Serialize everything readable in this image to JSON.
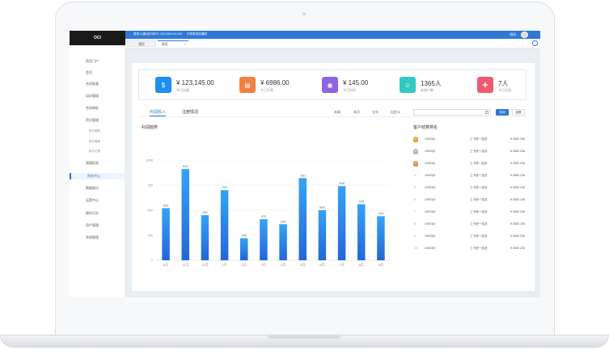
{
  "topbar": {
    "info": "登录人(最近访问IP): 192.168.104.216",
    "notice": "IP异常告知通知",
    "user": "测试"
  },
  "tabs": [
    {
      "label": "首页"
    },
    {
      "label": "首页",
      "close": "×"
    }
  ],
  "sidebar": {
    "logo": "OCI",
    "items": [
      {
        "label": "首页门户"
      },
      {
        "label": "会员"
      },
      {
        "label": "合同准备"
      },
      {
        "label": "培训管理"
      },
      {
        "label": "合同审批"
      },
      {
        "label": "积分管理"
      },
      {
        "label": "积分规则",
        "sub": true
      },
      {
        "label": "积分商城",
        "sub": true
      },
      {
        "label": "积分记录",
        "sub": true
      },
      {
        "label": "通量报表"
      },
      {
        "label": "财务中心",
        "active": true
      },
      {
        "label": "数据统计"
      },
      {
        "label": "运营中心"
      },
      {
        "label": "操作日志"
      },
      {
        "label": "用户管理"
      },
      {
        "label": "系统管理"
      }
    ]
  },
  "stats": [
    {
      "icon": "upload-money-icon",
      "color": "#1e8ff0",
      "value": "¥ 123,145.00",
      "label": "今日总额"
    },
    {
      "icon": "receipt-icon",
      "color": "#f08140",
      "value": "¥ 6986.00",
      "label": "今日开票"
    },
    {
      "icon": "coins-icon",
      "color": "#8e63e6",
      "value": "¥ 145.00",
      "label": "今日利润"
    },
    {
      "icon": "users-icon",
      "color": "#30c9c3",
      "value": "1365人",
      "label": "新增户数"
    },
    {
      "icon": "user-add-icon",
      "color": "#f05a70",
      "value": "7人",
      "label": "今日注册"
    }
  ],
  "section_tabs": [
    {
      "label": "利润收入"
    },
    {
      "label": "注册情况"
    }
  ],
  "filters": [
    "本周",
    "本月",
    "全年",
    "自定义"
  ],
  "buttons": {
    "query": "查询",
    "reset": "重置"
  },
  "chart_data": {
    "type": "bar",
    "title": "利润趋势",
    "categories": [
      "8月",
      "11月",
      "12月",
      "1月",
      "2月",
      "3月",
      "4月",
      "5月",
      "6月",
      "7月",
      "8月",
      "9月"
    ],
    "values": [
      520,
      910,
      450,
      700,
      220,
      410,
      360,
      820,
      500,
      740,
      560,
      440
    ],
    "data_labels": [
      "520",
      "910",
      "430",
      "700",
      "240",
      "470",
      "320",
      "780",
      "500",
      "695",
      "525",
      "470"
    ],
    "yticks": [
      "0",
      "250",
      "500",
      "750",
      "1000"
    ],
    "ylim": [
      0,
      1000
    ],
    "color": "#2e86ec"
  },
  "ranking": {
    "title": "客户结算排名",
    "rows": [
      {
        "rank": "1",
        "id": "10003(5",
        "name": "工卡统一结总",
        "amount": "¥ 3562.236"
      },
      {
        "rank": "2",
        "id": "10003(5",
        "name": "工卡统一结总",
        "amount": "¥ 3562.236"
      },
      {
        "rank": "3",
        "id": "10003(5",
        "name": "工卡统一结总",
        "amount": "¥ 3562.236"
      },
      {
        "rank": "4",
        "id": "10003(5",
        "name": "工卡统一结总",
        "amount": "¥ 3562.236"
      },
      {
        "rank": "5",
        "id": "10003(5",
        "name": "工卡统一结总",
        "amount": "¥ 3562.236"
      },
      {
        "rank": "6",
        "id": "10003(5",
        "name": "工卡统一结总",
        "amount": "¥ 3562.236"
      },
      {
        "rank": "7",
        "id": "10003(5",
        "name": "工卡统一结总",
        "amount": "¥ 3562.236"
      },
      {
        "rank": "8",
        "id": "10003(5",
        "name": "工卡统一结总",
        "amount": "¥ 3562.236"
      },
      {
        "rank": "9",
        "id": "10003(5",
        "name": "工卡统一结总",
        "amount": "¥ 3562.236"
      },
      {
        "rank": "10",
        "id": "10003(5",
        "name": "工卡统一结总",
        "amount": "¥ 3562.236"
      }
    ],
    "badge_colors": [
      "#f0a030",
      "#b0b6c0",
      "#e0904a"
    ]
  }
}
